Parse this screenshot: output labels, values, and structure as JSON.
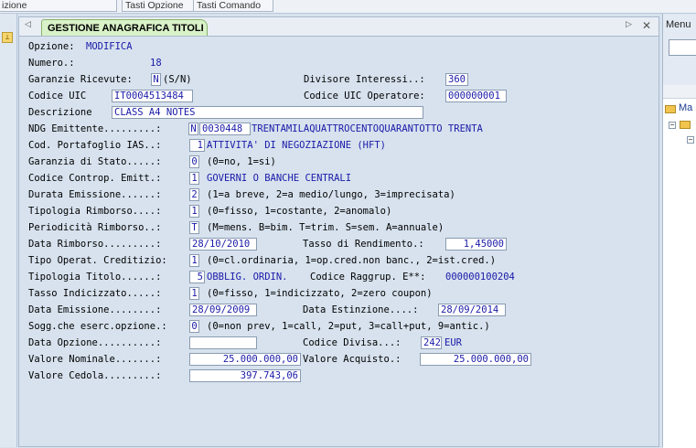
{
  "toolbar": {
    "btn0": "izione",
    "btn1": "Tasti Opzione",
    "btn2": "Tasti Comando"
  },
  "tab": {
    "title": "GESTIONE ANAGRAFICA TITOLI"
  },
  "form": {
    "opzione_label": "Opzione:",
    "opzione_value": "MODIFICA",
    "numero_label": "Numero.:",
    "numero_value": "18",
    "garanzie_label": "Garanzie Ricevute:",
    "garanzie_value": "N",
    "garanzie_hint": "(S/N)",
    "divisore_label": "Divisore Interessi..:",
    "divisore_value": "360",
    "uic_label": "Codice UIC",
    "uic_value": "IT0004513484",
    "uic_op_label": "Codice UIC Operatore:",
    "uic_op_value": "000000001",
    "descrizione_label": "Descrizione",
    "descrizione_value": "CLASS A4 NOTES",
    "ndg_label": "NDG Emittente.........:",
    "ndg_flag": "N",
    "ndg_code": "0030448",
    "ndg_desc": "TRENTAMILAQUATTROCENTOQUARANTOTTO TRENTA",
    "portafoglio_label": "Cod. Portafoglio IAS..:",
    "portafoglio_value": "1",
    "portafoglio_desc": "ATTIVITA' DI NEGOZIAZIONE (HFT)",
    "garanzia_stato_label": "Garanzia di Stato.....:",
    "garanzia_stato_value": "0",
    "garanzia_stato_hint": "(0=no, 1=si)",
    "controp_label": "Codice Controp. Emitt.:",
    "controp_value": "1",
    "controp_desc": "GOVERNI O BANCHE CENTRALI",
    "durata_label": "Durata Emissione......:",
    "durata_value": "2",
    "durata_hint": "(1=a breve, 2=a medio/lungo, 3=imprecisata)",
    "tip_rimborso_label": "Tipologia Rimborso....:",
    "tip_rimborso_value": "1",
    "tip_rimborso_hint": "(0=fisso, 1=costante, 2=anomalo)",
    "periodicita_label": "Periodicità Rimborso..:",
    "periodicita_value": "T",
    "periodicita_hint": "(M=mens. B=bim. T=trim. S=sem. A=annuale)",
    "data_rimborso_label": "Data Rimborso.........:",
    "data_rimborso_value": "28/10/2010",
    "tasso_rend_label": "Tasso di Rendimento.:",
    "tasso_rend_value": "1,45000",
    "tipo_operat_label": "Tipo Operat. Creditizio:",
    "tipo_operat_value": "1",
    "tipo_operat_hint": "(0=cl.ordinaria, 1=op.cred.non banc., 2=ist.cred.)",
    "tip_titolo_label": "Tipologia Titolo......:",
    "tip_titolo_value": "5",
    "tip_titolo_desc": "OBBLIG. ORDIN.",
    "raggrup_label": "Codice Raggrup. E**:",
    "raggrup_value": "000000100204",
    "tasso_ind_label": "Tasso Indicizzato.....:",
    "tasso_ind_value": "1",
    "tasso_ind_hint": "(0=fisso, 1=indicizzato, 2=zero coupon)",
    "data_emissione_label": "Data Emissione........:",
    "data_emissione_value": "28/09/2009",
    "data_estinzione_label": "Data Estinzione....:",
    "data_estinzione_value": "28/09/2014",
    "sogg_label": "Sogg.che eserc.opzione.:",
    "sogg_value": "0",
    "sogg_hint": "(0=non prev, 1=call, 2=put, 3=call+put, 9=antic.)",
    "data_opzione_label": "Data Opzione..........:",
    "data_opzione_value": "",
    "divisa_label": "Codice Divisa...:",
    "divisa_value": "242",
    "divisa_desc": "EUR",
    "val_nominale_label": "Valore Nominale.......:",
    "val_nominale_value": "25.000.000,00",
    "val_acquisto_label": "Valore Acquisto.:",
    "val_acquisto_value": "25.000.000,00",
    "val_cedola_label": "Valore Cedola.........:",
    "val_cedola_value": "397.743,06"
  },
  "right_panel": {
    "title": "Menu",
    "tree_item": "Ma"
  },
  "colors": {
    "value_text": "#1a1aa8",
    "tab_bg": "#d9f2c8",
    "window_bg": "#d7e2ee"
  }
}
